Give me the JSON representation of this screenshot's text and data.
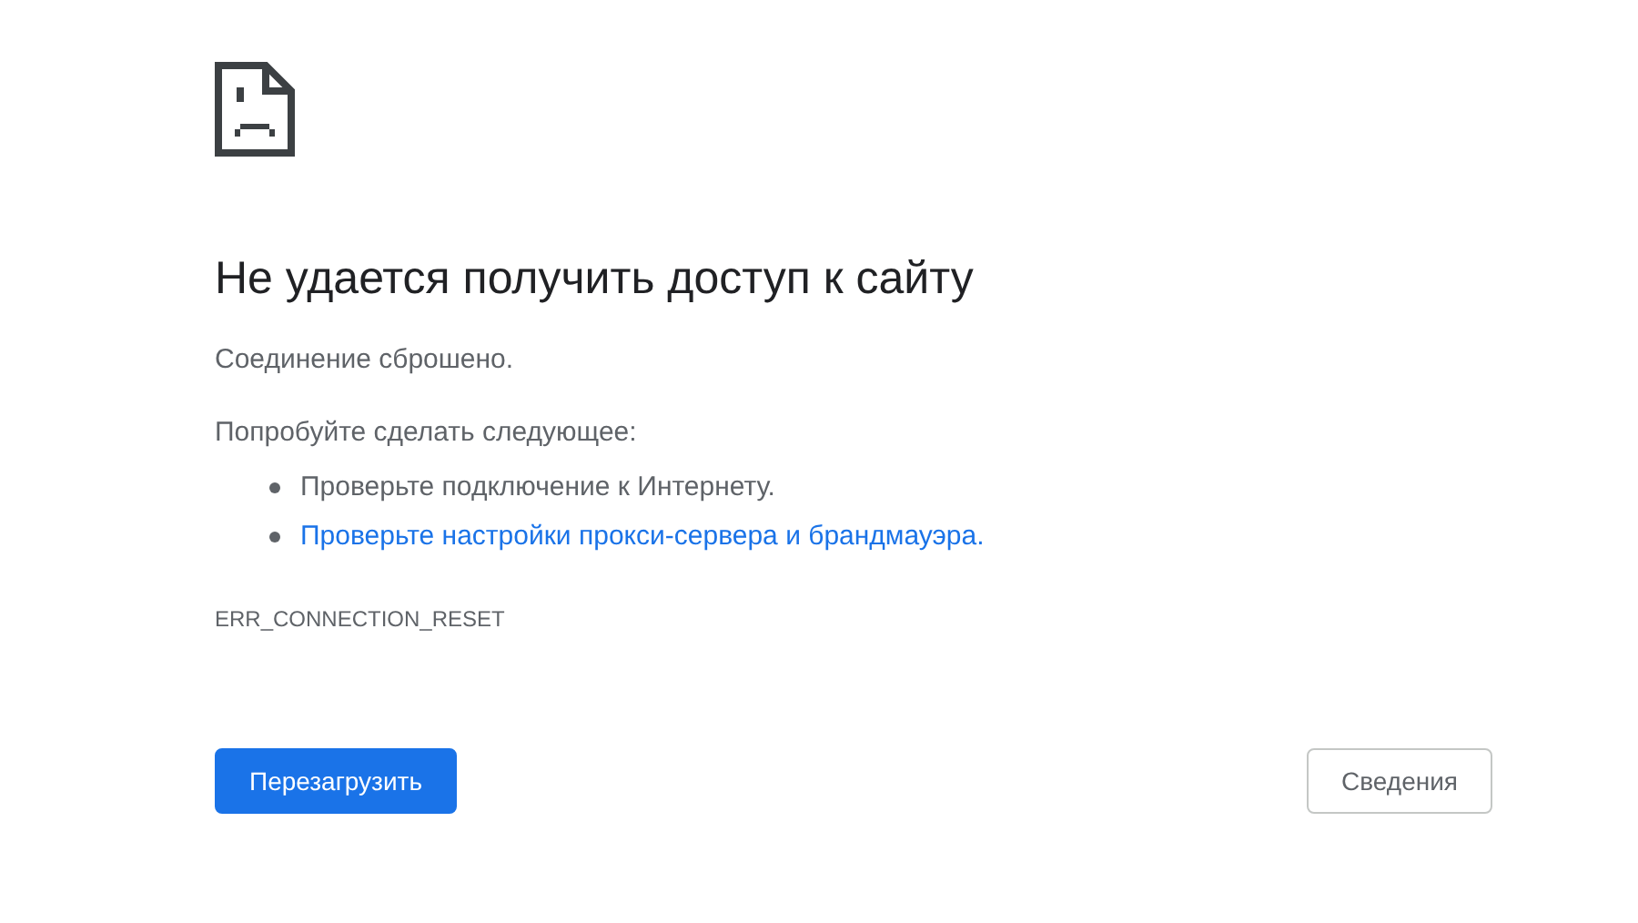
{
  "title": "Не удается получить доступ к сайту",
  "subtitle": "Соединение сброшено.",
  "suggestions_heading": "Попробуйте сделать следующее:",
  "suggestions": [
    {
      "kind": "text",
      "label": "Проверьте подключение к Интернету."
    },
    {
      "kind": "link",
      "label": "Проверьте настройки прокси-сервера и брандмауэра."
    }
  ],
  "error_code": "ERR_CONNECTION_RESET",
  "buttons": [
    {
      "kind": "primary",
      "label": "Перезагрузить"
    },
    {
      "kind": "secondary",
      "label": "Сведения"
    }
  ]
}
